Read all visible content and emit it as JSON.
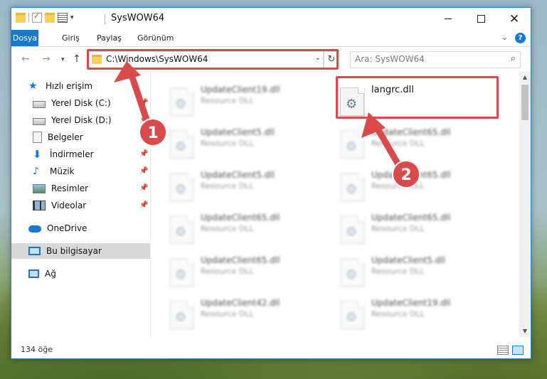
{
  "window": {
    "title": "SysWOW64",
    "controls": {
      "minimize": "minimize",
      "maximize": "maximize",
      "close": "✕"
    }
  },
  "ribbon": {
    "tabs": [
      {
        "label": "Dosya"
      },
      {
        "label": "Giriş"
      },
      {
        "label": "Paylaş"
      },
      {
        "label": "Görünüm"
      }
    ],
    "help": "?"
  },
  "address_bar": {
    "path": "C:\\Windows\\SysWOW64",
    "search_placeholder": "Ara: SysWOW64"
  },
  "nav_pane": {
    "items": [
      {
        "label": "Hızlı erişim",
        "icon": "star-icon"
      },
      {
        "label": "Yerel Disk (C:)",
        "icon": "drive-icon"
      },
      {
        "label": "Yerel Disk (D:)",
        "icon": "drive-icon"
      },
      {
        "label": "Belgeler",
        "icon": "documents-icon"
      },
      {
        "label": "İndirmeler",
        "icon": "downloads-icon"
      },
      {
        "label": "Müzik",
        "icon": "music-icon"
      },
      {
        "label": "Resimler",
        "icon": "pictures-icon"
      },
      {
        "label": "Videolar",
        "icon": "videos-icon"
      },
      {
        "label": "OneDrive",
        "icon": "cloud-icon"
      },
      {
        "label": "Bu bilgisayar",
        "icon": "computer-icon",
        "selected": true
      },
      {
        "label": "Ağ",
        "icon": "network-icon"
      }
    ]
  },
  "files": [
    {
      "name": "UpdateClient19.dll",
      "type": "Resource DLL"
    },
    {
      "name": "langrc.dll",
      "type": ""
    },
    {
      "name": "UpdateClient5.dll",
      "type": "Resource DLL"
    },
    {
      "name": "UpdateClient65.dll",
      "type": "Resource DLL"
    },
    {
      "name": "UpdateClient5.dll",
      "type": "Resource DLL"
    },
    {
      "name": "UpdateClient65.dll",
      "type": "Resource DLL"
    },
    {
      "name": "UpdateClient65.dll",
      "type": "Resource DLL"
    },
    {
      "name": "UpdateClient65.dll",
      "type": "Resource DLL"
    },
    {
      "name": "UpdateClient65.dll",
      "type": "Resource DLL"
    },
    {
      "name": "UpdateClient5.dll",
      "type": "Resource DLL"
    },
    {
      "name": "UpdateClient42.dll",
      "type": "Resource DLL"
    },
    {
      "name": "UpdateClient19.dll",
      "type": "Resource DLL"
    }
  ],
  "status_bar": {
    "item_count": "134 öğe"
  },
  "annotations": {
    "step1": "1",
    "step2": "2",
    "highlight_color": "#d94b4b"
  },
  "colors": {
    "accent": "#1979ca",
    "annotation": "#d94b4b"
  }
}
